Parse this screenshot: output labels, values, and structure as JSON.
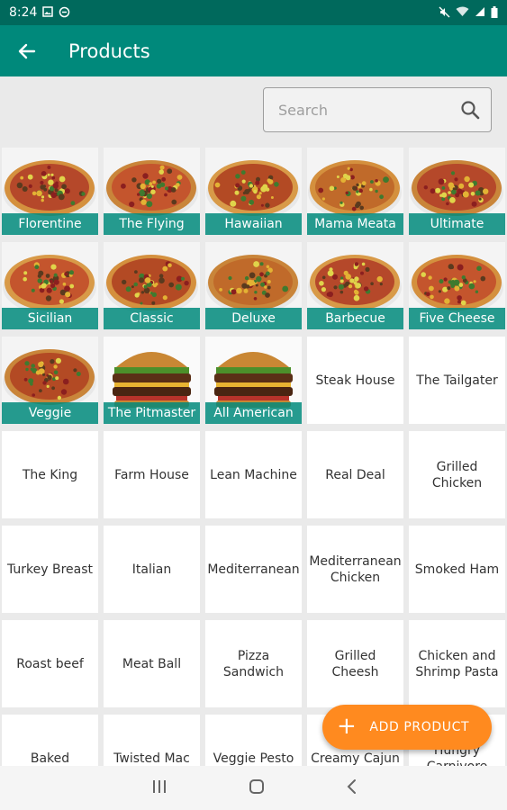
{
  "status_bar": {
    "time": "8:24",
    "left_icons": [
      "image-icon",
      "sync-icon"
    ],
    "right_icons": [
      "mute-icon",
      "wifi-icon",
      "signal-icon",
      "battery-icon"
    ]
  },
  "app_bar": {
    "title": "Products",
    "back_icon": "arrow-left-icon"
  },
  "search": {
    "placeholder": "Search",
    "value": "",
    "icon": "search-icon"
  },
  "products": [
    {
      "name": "Florentine",
      "image": "pizza"
    },
    {
      "name": "The Flying",
      "image": "pizza"
    },
    {
      "name": "Hawaiian",
      "image": "pizza"
    },
    {
      "name": "Mama Meata",
      "image": "pizza"
    },
    {
      "name": "Ultimate",
      "image": "pizza"
    },
    {
      "name": "Sicilian",
      "image": "pizza"
    },
    {
      "name": "Classic",
      "image": "pizza"
    },
    {
      "name": "Deluxe",
      "image": "pizza"
    },
    {
      "name": "Barbecue",
      "image": "pizza"
    },
    {
      "name": "Five Cheese",
      "image": "pizza"
    },
    {
      "name": "Veggie",
      "image": "pizza"
    },
    {
      "name": "The Pitmaster",
      "image": "burger"
    },
    {
      "name": "All American",
      "image": "burger"
    },
    {
      "name": "Steak House"
    },
    {
      "name": "The Tailgater"
    },
    {
      "name": "The King"
    },
    {
      "name": "Farm House"
    },
    {
      "name": "Lean Machine"
    },
    {
      "name": "Real Deal"
    },
    {
      "name": "Grilled Chicken"
    },
    {
      "name": "Turkey Breast"
    },
    {
      "name": "Italian"
    },
    {
      "name": "Mediterranean"
    },
    {
      "name": "Mediterranean Chicken"
    },
    {
      "name": "Smoked Ham"
    },
    {
      "name": "Roast beef"
    },
    {
      "name": "Meat Ball"
    },
    {
      "name": "Pizza Sandwich"
    },
    {
      "name": "Grilled Cheesh"
    },
    {
      "name": "Chicken and Shrimp Pasta"
    },
    {
      "name": "Baked"
    },
    {
      "name": "Twisted Mac"
    },
    {
      "name": "Veggie Pesto"
    },
    {
      "name": "Creamy Cajun"
    },
    {
      "name": "Hungry Carnivore"
    }
  ],
  "fab": {
    "label": "ADD PRODUCT",
    "icon": "plus-icon",
    "color": "#ff8a1f"
  },
  "nav_bar": {
    "icons": [
      "recents-icon",
      "home-icon",
      "back-icon"
    ]
  },
  "colors": {
    "primary": "#00897b",
    "primary_dark": "#00695c",
    "accent": "#ff8a1f"
  }
}
